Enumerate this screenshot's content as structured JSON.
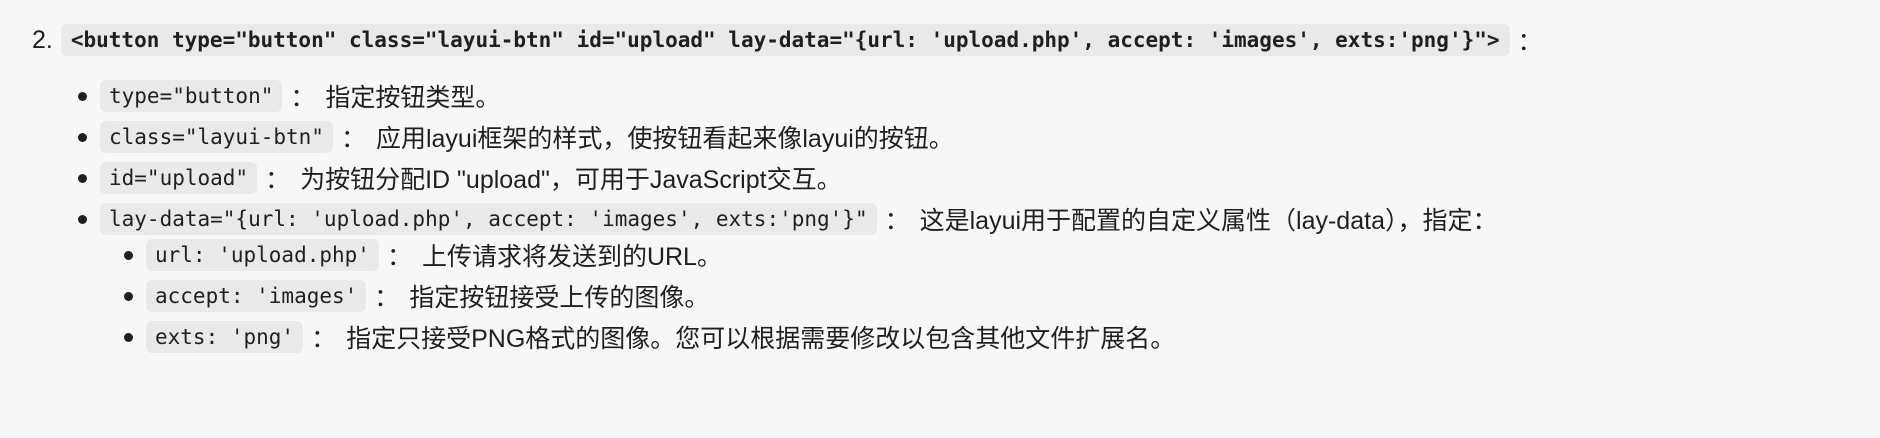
{
  "item2": {
    "number": "2.",
    "code": "<button type=\"button\" class=\"layui-btn\" id=\"upload\" lay-data=\"{url: 'upload.php', accept: 'images', exts:'png'}\">",
    "suffix": "："
  },
  "bullets": [
    {
      "code": "type=\"button\"",
      "sep": "：",
      "text": "指定按钮类型。"
    },
    {
      "code": "class=\"layui-btn\"",
      "sep": "：",
      "text": "应用layui框架的样式，使按钮看起来像layui的按钮。"
    },
    {
      "code": "id=\"upload\"",
      "sep": "：",
      "text": "为按钮分配ID \"upload\"，可用于JavaScript交互。"
    },
    {
      "code": "lay-data=\"{url: 'upload.php', accept: 'images', exts:'png'}\"",
      "sep": "：",
      "text": "这是layui用于配置的自定义属性（lay-data），指定："
    }
  ],
  "sub_bullets": [
    {
      "code": "url: 'upload.php'",
      "sep": "：",
      "text": "上传请求将发送到的URL。"
    },
    {
      "code": "accept: 'images'",
      "sep": "：",
      "text": "指定按钮接受上传的图像。"
    },
    {
      "code": "exts: 'png'",
      "sep": "：",
      "text": "指定只接受PNG格式的图像。您可以根据需要修改以包含其他文件扩展名。"
    }
  ]
}
